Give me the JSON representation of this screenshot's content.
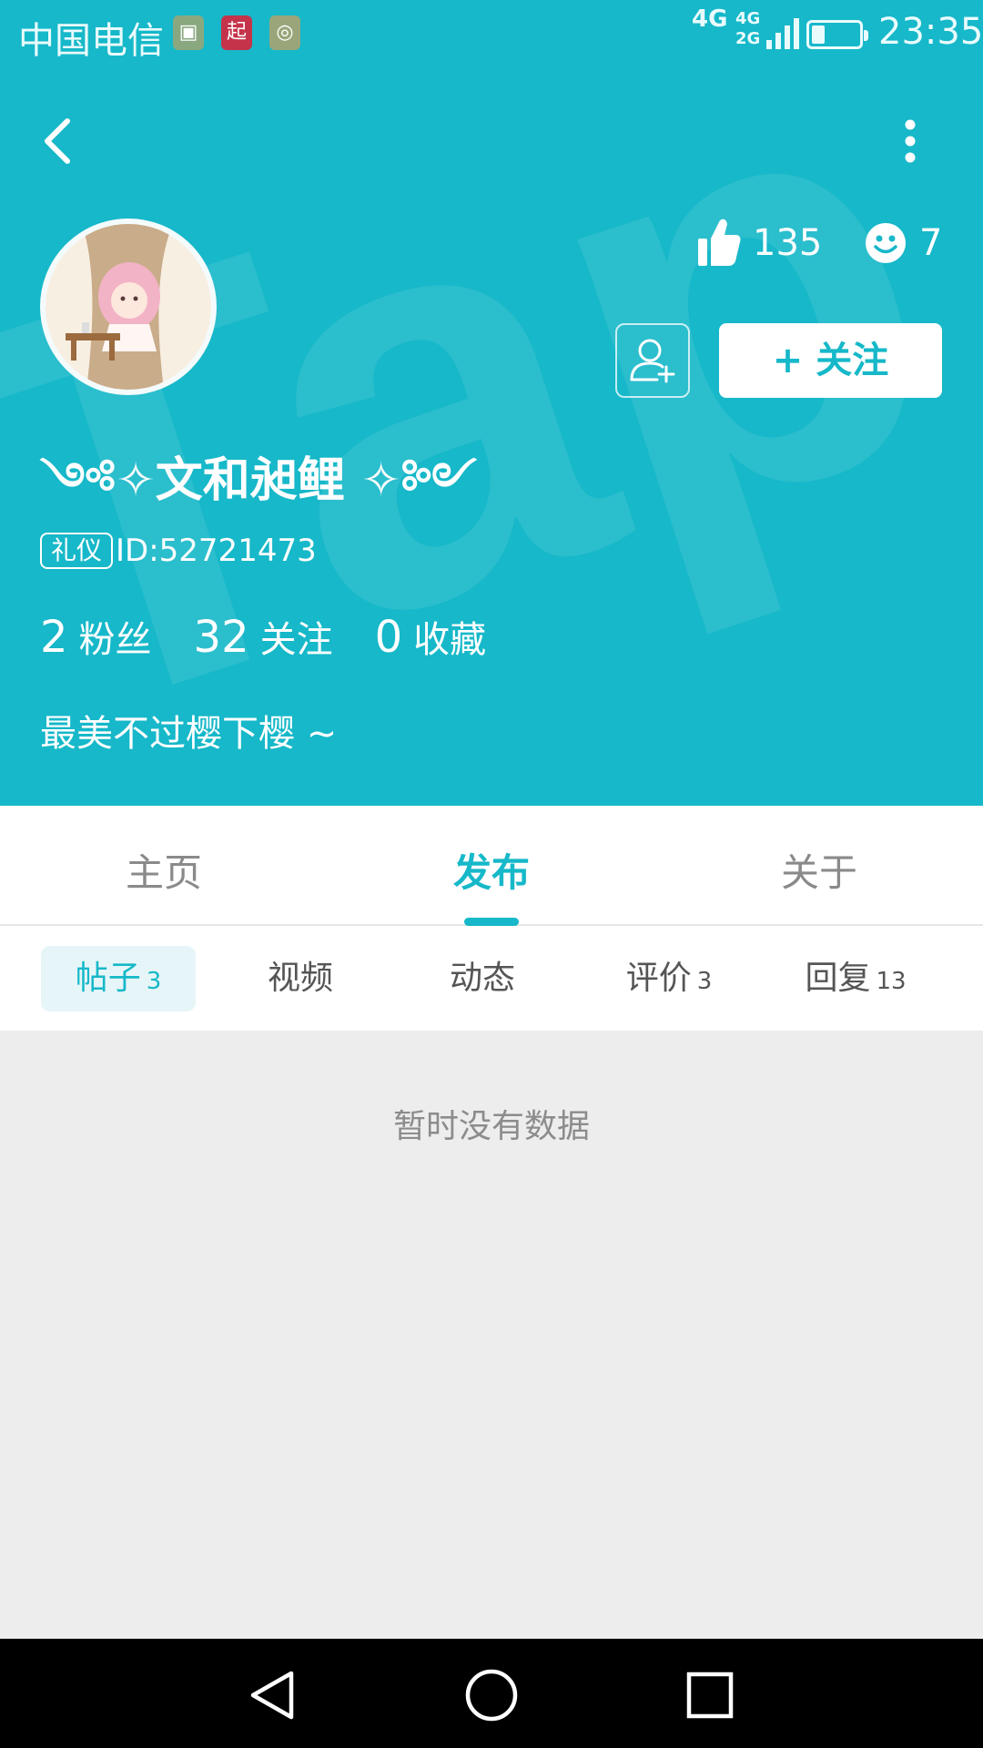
{
  "status_bar": {
    "carrier": "中国电信",
    "network_main": "4G",
    "network_secondary": "4G 2G",
    "time": "23:35",
    "notification_icons": [
      "gallery-icon",
      "qidian-icon",
      "app-icon"
    ]
  },
  "header": {
    "watermark": "Tap",
    "likes": "135",
    "smiles": "7",
    "follow_button": "+ 关注",
    "username": "༺✧文和昶鲤 ✧༻",
    "badge": "礼仪",
    "user_id": "ID:52721473",
    "stats": [
      {
        "value": "2",
        "label": "粉丝"
      },
      {
        "value": "32",
        "label": "关注"
      },
      {
        "value": "0",
        "label": "收藏"
      }
    ],
    "bio": "最美不过樱下樱 ~"
  },
  "main_tabs": [
    {
      "label": "主页",
      "active": false
    },
    {
      "label": "发布",
      "active": true
    },
    {
      "label": "关于",
      "active": false
    }
  ],
  "sub_tabs": [
    {
      "label": "帖子",
      "count": "3",
      "active": true
    },
    {
      "label": "视频",
      "count": "",
      "active": false
    },
    {
      "label": "动态",
      "count": "",
      "active": false
    },
    {
      "label": "评价",
      "count": "3",
      "active": false
    },
    {
      "label": "回复",
      "count": "13",
      "active": false
    }
  ],
  "empty_state": "暂时没有数据",
  "colors": {
    "accent": "#16b8c9",
    "background": "#ededed",
    "nav_bar": "#000000"
  },
  "nav_icons": [
    "back-triangle-icon",
    "home-circle-icon",
    "recents-square-icon"
  ]
}
